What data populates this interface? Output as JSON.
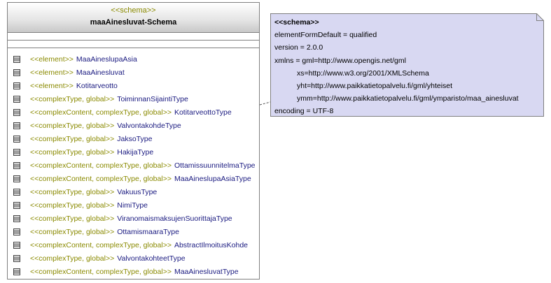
{
  "class_box": {
    "stereotype": "<<schema>>",
    "name": "maaAinesluvat-Schema",
    "items": [
      {
        "stereo": "<<element>>",
        "name": "MaaAineslupaAsia"
      },
      {
        "stereo": "<<element>>",
        "name": "MaaAinesluvat"
      },
      {
        "stereo": "<<element>>",
        "name": "Kotitarveotto"
      },
      {
        "stereo": "<<complexType, global>>",
        "name": "ToiminnanSijaintiType"
      },
      {
        "stereo": "<<complexContent, complexType, global>>",
        "name": "KotitarveottoType"
      },
      {
        "stereo": "<<complexType, global>>",
        "name": "ValvontakohdeType"
      },
      {
        "stereo": "<<complexType, global>>",
        "name": "JaksoType"
      },
      {
        "stereo": "<<complexType, global>>",
        "name": "HakijaType"
      },
      {
        "stereo": "<<complexContent, complexType, global>>",
        "name": "OttamissuunnitelmaType"
      },
      {
        "stereo": "<<complexContent, complexType, global>>",
        "name": "MaaAineslupaAsiaType"
      },
      {
        "stereo": "<<complexType, global>>",
        "name": "VakuusType"
      },
      {
        "stereo": "<<complexType, global>>",
        "name": "NimiType"
      },
      {
        "stereo": "<<complexType, global>>",
        "name": "ViranomaismaksujenSuorittajaType"
      },
      {
        "stereo": "<<complexType, global>>",
        "name": "OttamismaaraType"
      },
      {
        "stereo": "<<complexContent, complexType, global>>",
        "name": "AbstractIlmoitusKohde"
      },
      {
        "stereo": "<<complexType, global>>",
        "name": "ValvontakohteetType"
      },
      {
        "stereo": "<<complexContent, complexType, global>>",
        "name": "MaaAinesluvatType"
      }
    ]
  },
  "note": {
    "title": "<<schema>>",
    "lines": [
      {
        "text": "elementFormDefault = qualified",
        "indent": false
      },
      {
        "text": "version = 2.0.0",
        "indent": false
      },
      {
        "text": "xmlns = gml=http://www.opengis.net/gml",
        "indent": false
      },
      {
        "text": "xs=http://www.w3.org/2001/XMLSchema",
        "indent": true
      },
      {
        "text": "yht=http://www.paikkatietopalvelu.fi/gml/yhteiset",
        "indent": true
      },
      {
        "text": "ymm=http://www.paikkatietopalvelu.fi/gml/ymparisto/maa_ainesluvat",
        "indent": true
      },
      {
        "text": "encoding = UTF-8",
        "indent": false
      }
    ]
  },
  "colors": {
    "note_fill": "#d8d8f2",
    "note_border": "#808080",
    "stereotype": "#8a8a00",
    "item_name": "#1a1a80"
  },
  "icons": {
    "item_icon": "attribute-list-icon"
  }
}
